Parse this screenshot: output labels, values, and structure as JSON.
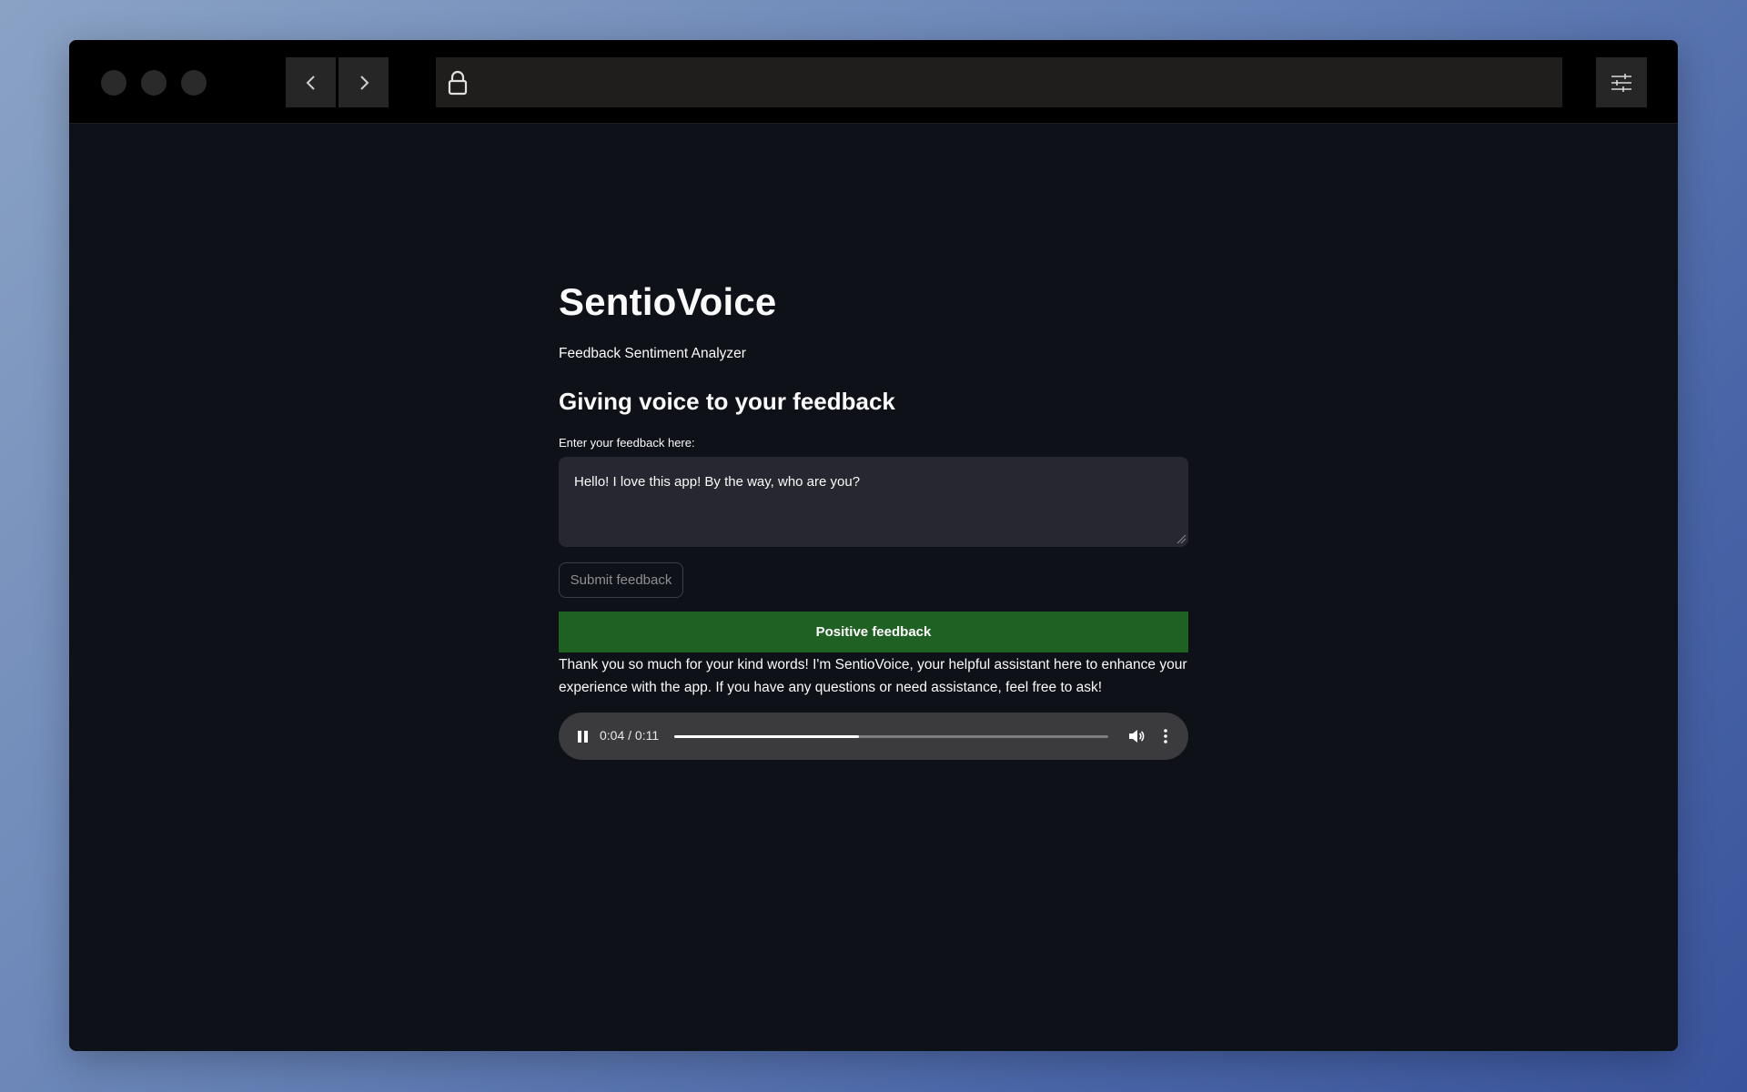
{
  "colors": {
    "app_background": "#0e1117",
    "text": "#fafafa",
    "positive_banner": "#1f6023",
    "input_background": "#262730",
    "player_background": "#3b3b3d"
  },
  "browser": {
    "icons": {
      "back": "chevron-left-icon",
      "forward": "chevron-right-icon",
      "lock": "lock-icon",
      "settings": "sliders-icon"
    }
  },
  "app": {
    "title": "SentioVoice",
    "subtitle": "Feedback Sentiment Analyzer",
    "heading": "Giving voice to your feedback",
    "feedback_label": "Enter your feedback here:",
    "feedback_value": "Hello! I love this app! By the way, who are you?",
    "submit_label": "Submit feedback",
    "sentiment_label": "Positive feedback",
    "response": "Thank you so much for your kind words! I'm SentioVoice, your helpful assistant here to enhance your experience with the app. If you have any questions or need assistance, feel free to ask!"
  },
  "audio": {
    "time_display": "0:04 / 0:11",
    "progress_fraction": 0.425,
    "state": "playing",
    "icons": {
      "pause": "pause-icon",
      "volume": "volume-icon",
      "more": "more-vertical-icon"
    }
  }
}
